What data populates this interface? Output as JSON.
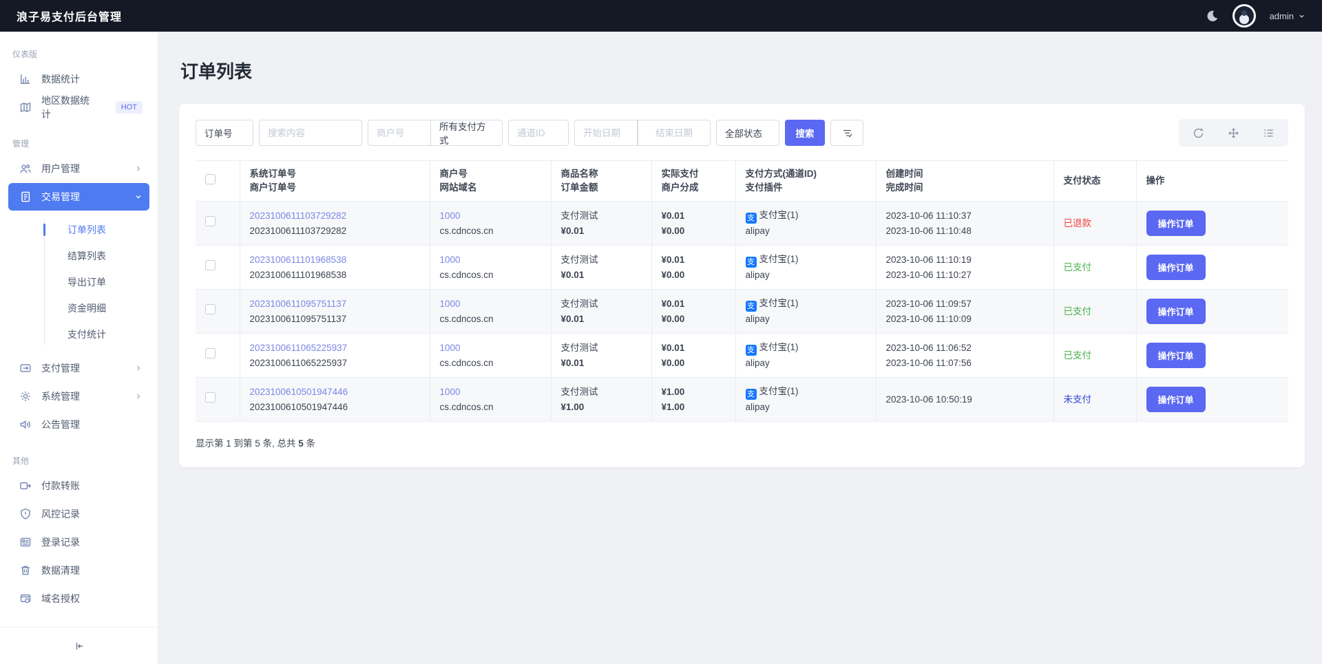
{
  "colors": {
    "topbar_bg": "#141925",
    "accent_button": "#5a68f2",
    "sidebar_active": "#4e7bf0",
    "link": "#7b87e6",
    "alipay_blue": "#1678ff",
    "status_refunded": "#f2413e",
    "status_paid": "#45b14a",
    "status_unpaid": "#2c44d8"
  },
  "topbar": {
    "title": "浪子易支付后台管理",
    "username": "admin"
  },
  "sidebar": {
    "sections": [
      {
        "label": "仪表版",
        "items": [
          {
            "label": "数据统计"
          },
          {
            "label": "地区数据统计",
            "badge": "HOT"
          }
        ]
      },
      {
        "label": "管理",
        "items": [
          {
            "label": "用户管理"
          },
          {
            "label": "交易管理"
          },
          {
            "label": "支付管理"
          },
          {
            "label": "系统管理"
          },
          {
            "label": "公告管理"
          }
        ]
      },
      {
        "label": "其他",
        "items": [
          {
            "label": "付款转账"
          },
          {
            "label": "风控记录"
          },
          {
            "label": "登录记录"
          },
          {
            "label": "数据清理"
          },
          {
            "label": "域名授权"
          }
        ]
      }
    ],
    "submenu": {
      "items": [
        "订单列表",
        "结算列表",
        "导出订单",
        "资金明细",
        "支付统计"
      ],
      "active": "订单列表"
    }
  },
  "page": {
    "title": "订单列表"
  },
  "filters": {
    "order_field": "订单号",
    "search_placeholder": "搜索内容",
    "merchant_placeholder": "商户号",
    "pay_method": "所有支付方式",
    "channel_placeholder": "通道ID",
    "start_date_placeholder": "开始日期",
    "end_date_placeholder": "结束日期",
    "status": "全部状态",
    "search_label": "搜索"
  },
  "table": {
    "headers": [
      {
        "l1": "系统订单号",
        "l2": "商户订单号"
      },
      {
        "l1": "商户号",
        "l2": "网站域名"
      },
      {
        "l1": "商品名称",
        "l2": "订单金额"
      },
      {
        "l1": "实际支付",
        "l2": "商户分成"
      },
      {
        "l1": "支付方式(通道ID)",
        "l2": "支付插件"
      },
      {
        "l1": "创建时间",
        "l2": "完成时间"
      },
      {
        "l1": "支付状态",
        "l2": ""
      },
      {
        "l1": "操作",
        "l2": ""
      }
    ],
    "rows": [
      {
        "sys": "2023100611103729282",
        "mer": "2023100611103729282",
        "mid": "1000",
        "domain": "cs.cdncos.cn",
        "product": "支付测试",
        "amount": "¥0.01",
        "paid": "¥0.01",
        "share": "¥0.00",
        "method": "支付宝(1)",
        "plugin": "alipay",
        "created": "2023-10-06 11:10:37",
        "completed": "2023-10-06 11:10:48",
        "status": "已退款",
        "action": "操作订单"
      },
      {
        "sys": "2023100611101968538",
        "mer": "2023100611101968538",
        "mid": "1000",
        "domain": "cs.cdncos.cn",
        "product": "支付测试",
        "amount": "¥0.01",
        "paid": "¥0.01",
        "share": "¥0.00",
        "method": "支付宝(1)",
        "plugin": "alipay",
        "created": "2023-10-06 11:10:19",
        "completed": "2023-10-06 11:10:27",
        "status": "已支付",
        "action": "操作订单"
      },
      {
        "sys": "2023100611095751137",
        "mer": "2023100611095751137",
        "mid": "1000",
        "domain": "cs.cdncos.cn",
        "product": "支付测试",
        "amount": "¥0.01",
        "paid": "¥0.01",
        "share": "¥0.00",
        "method": "支付宝(1)",
        "plugin": "alipay",
        "created": "2023-10-06 11:09:57",
        "completed": "2023-10-06 11:10:09",
        "status": "已支付",
        "action": "操作订单"
      },
      {
        "sys": "2023100611065225937",
        "mer": "2023100611065225937",
        "mid": "1000",
        "domain": "cs.cdncos.cn",
        "product": "支付测试",
        "amount": "¥0.01",
        "paid": "¥0.01",
        "share": "¥0.00",
        "method": "支付宝(1)",
        "plugin": "alipay",
        "created": "2023-10-06 11:06:52",
        "completed": "2023-10-06 11:07:56",
        "status": "已支付",
        "action": "操作订单"
      },
      {
        "sys": "2023100610501947446",
        "mer": "2023100610501947446",
        "mid": "1000",
        "domain": "cs.cdncos.cn",
        "product": "支付测试",
        "amount": "¥1.00",
        "paid": "¥1.00",
        "share": "¥1.00",
        "method": "支付宝(1)",
        "plugin": "alipay",
        "created": "2023-10-06 10:50:19",
        "completed": "",
        "status": "未支付",
        "action": "操作订单"
      }
    ]
  },
  "pagination": {
    "prefix": "显示第 1 到第 5 条, 总共 ",
    "total": "5",
    "suffix": " 条"
  }
}
